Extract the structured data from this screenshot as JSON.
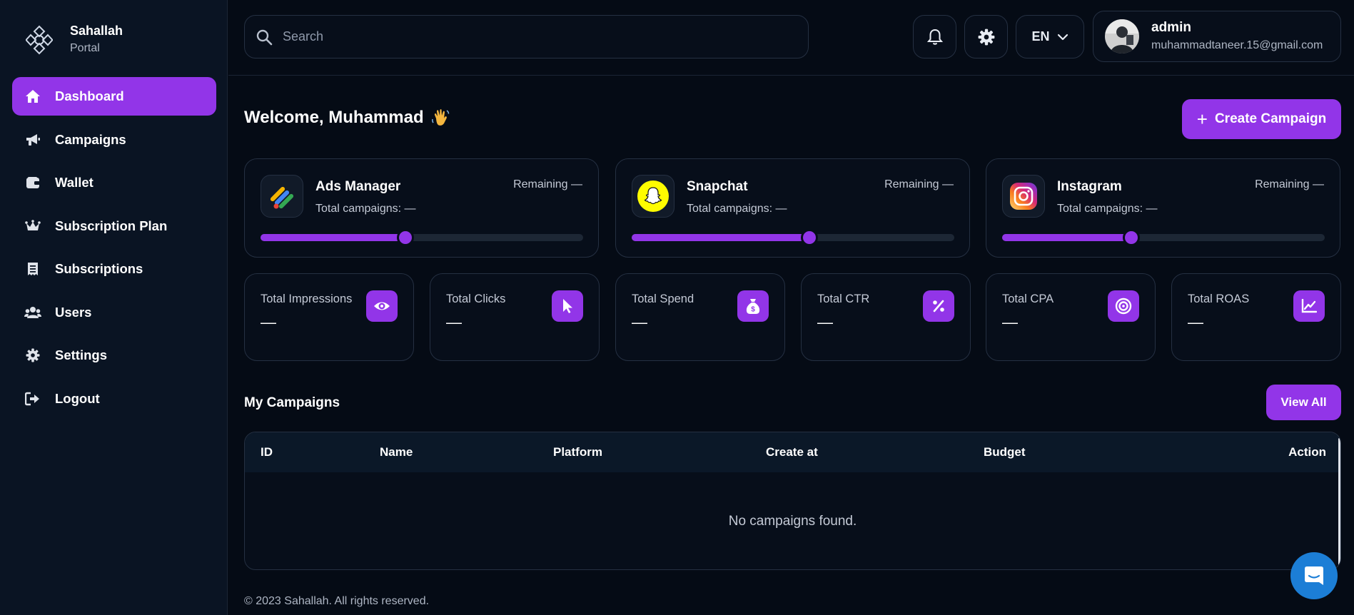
{
  "brand": {
    "name": "Sahallah",
    "subtitle": "Portal"
  },
  "sidebar": {
    "items": [
      {
        "label": "Dashboard",
        "icon": "home-icon",
        "active": true
      },
      {
        "label": "Campaigns",
        "icon": "megaphone-icon"
      },
      {
        "label": "Wallet",
        "icon": "wallet-icon"
      },
      {
        "label": "Subscription Plan",
        "icon": "crown-icon"
      },
      {
        "label": "Subscriptions",
        "icon": "receipt-icon"
      },
      {
        "label": "Users",
        "icon": "users-icon"
      },
      {
        "label": "Settings",
        "icon": "gear-icon"
      },
      {
        "label": "Logout",
        "icon": "logout-icon"
      }
    ]
  },
  "header": {
    "search_placeholder": "Search",
    "language": "EN",
    "user": {
      "name": "admin",
      "email": "muhammadtaneer.15@gmail.com"
    }
  },
  "main": {
    "welcome": "Welcome, Muhammad",
    "create_campaign_label": "Create Campaign",
    "platforms": [
      {
        "name": "Ads Manager",
        "total_label": "Total campaigns: —",
        "remaining_label": "Remaining —",
        "icon": "ads-manager-icon",
        "progress": 0.45
      },
      {
        "name": "Snapchat",
        "total_label": "Total campaigns: —",
        "remaining_label": "Remaining —",
        "icon": "snapchat-icon",
        "progress": 0.55
      },
      {
        "name": "Instagram",
        "total_label": "Total campaigns: —",
        "remaining_label": "Remaining —",
        "icon": "instagram-icon",
        "progress": 0.4
      }
    ],
    "stats": [
      {
        "label": "Total Impressions",
        "value": "—",
        "icon": "eye-icon"
      },
      {
        "label": "Total Clicks",
        "value": "—",
        "icon": "cursor-icon"
      },
      {
        "label": "Total Spend",
        "value": "—",
        "icon": "money-bag-icon"
      },
      {
        "label": "Total CTR",
        "value": "—",
        "icon": "percent-icon"
      },
      {
        "label": "Total CPA",
        "value": "—",
        "icon": "target-icon"
      },
      {
        "label": "Total ROAS",
        "value": "—",
        "icon": "chart-line-icon"
      }
    ],
    "campaigns": {
      "title": "My Campaigns",
      "view_all_label": "View All",
      "columns": [
        "ID",
        "Name",
        "Platform",
        "Create at",
        "Budget",
        "Action"
      ],
      "empty_message": "No campaigns found."
    }
  },
  "footer": {
    "text": "© 2023 Sahallah. All rights reserved."
  },
  "colors": {
    "accent": "#9235e8",
    "background": "#050b15",
    "sidebar": "#0a1423",
    "chat": "#1c7ed6"
  }
}
